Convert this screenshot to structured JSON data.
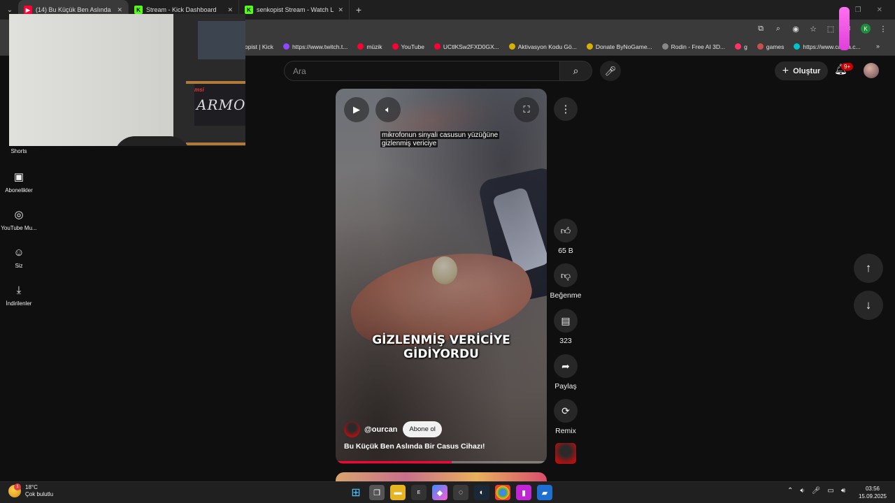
{
  "browser": {
    "tabs": [
      {
        "title": "(14) Bu Küçük Ben Aslında Bir C",
        "favicon": "youtube-icon",
        "active": true
      },
      {
        "title": "Stream - Kick Dashboard",
        "favicon": "kick-icon",
        "active": false
      },
      {
        "title": "senkopist Stream - Watch Live o",
        "favicon": "kick-icon",
        "active": false
      }
    ],
    "profile_initial": "K",
    "bookmarks": [
      {
        "label": "opist | Kick",
        "color": "#53fc18"
      },
      {
        "label": "https://www.twitch.t...",
        "color": "#9146ff"
      },
      {
        "label": "müzik",
        "color": "#ff0033"
      },
      {
        "label": "YouTube",
        "color": "#ff0033"
      },
      {
        "label": "UCtlKSw2FXD0GX...",
        "color": "#ff0033"
      },
      {
        "label": "Aktivasyon Kodu Gö...",
        "color": "#d8b000"
      },
      {
        "label": "Donate ByNoGame...",
        "color": "#d8b000"
      },
      {
        "label": "Rodin - Free AI 3D...",
        "color": "#888888"
      },
      {
        "label": "g",
        "color": "#ff3366"
      },
      {
        "label": "games",
        "color": "#c85050"
      },
      {
        "label": "https://www.canva.c...",
        "color": "#00c4cc"
      }
    ]
  },
  "webcam": {
    "brand1": "msi",
    "brand2": "ARMOR"
  },
  "sidebar": {
    "items": [
      {
        "label": "Shorts",
        "icon": "shorts-icon"
      },
      {
        "label": "Abonelikler",
        "icon": "subscriptions-icon"
      },
      {
        "label": "YouTube Mu...",
        "icon": "youtube-music-icon"
      },
      {
        "label": "Siz",
        "icon": "you-icon"
      },
      {
        "label": "İndirilenler",
        "icon": "download-icon"
      }
    ]
  },
  "header": {
    "search_placeholder": "Ara",
    "create_label": "Oluştur",
    "notification_count": "9+"
  },
  "short": {
    "caption_line1": "mikrofonun sinyali casusun yüzüğüne",
    "caption_line2": "gizlenmiş vericiye",
    "overlay_line1": "GİZLENMİŞ VERİCİYE",
    "overlay_line2": "GİDİYORDU",
    "channel": "@ourcan",
    "subscribe_label": "Abone ol",
    "title": "Bu Küçük Ben Aslında Bir Casus Cihazı!",
    "progress": 0.55
  },
  "actions": {
    "like_count": "65 B",
    "dislike_label": "Beğenme",
    "comment_count": "323",
    "share_label": "Paylaş",
    "remix_label": "Remix"
  },
  "taskbar": {
    "temperature": "18°C",
    "weather_text": "Çok bulutlu",
    "weather_badge": "1",
    "time": "03:56",
    "date": "15.09.2025"
  }
}
